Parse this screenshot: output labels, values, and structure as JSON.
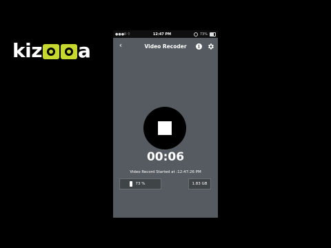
{
  "brand": {
    "logo_text_left": "kiz",
    "logo_text_right": "a"
  },
  "status_bar": {
    "carrier": "●●●ll ⌔",
    "time": "12:47 PM",
    "battery": "73%"
  },
  "nav": {
    "back_label": "‹",
    "title": "Video Recoder",
    "info_label": "i"
  },
  "recorder": {
    "timer": "00:06",
    "started_text": "Video Record Started at :12:47:26 PM",
    "battery_value": "73 %",
    "storage_value": "1.83 GB"
  },
  "colors": {
    "accent": "#c6d82f",
    "screen_bg": "#555b60",
    "record_button": "#000000"
  }
}
